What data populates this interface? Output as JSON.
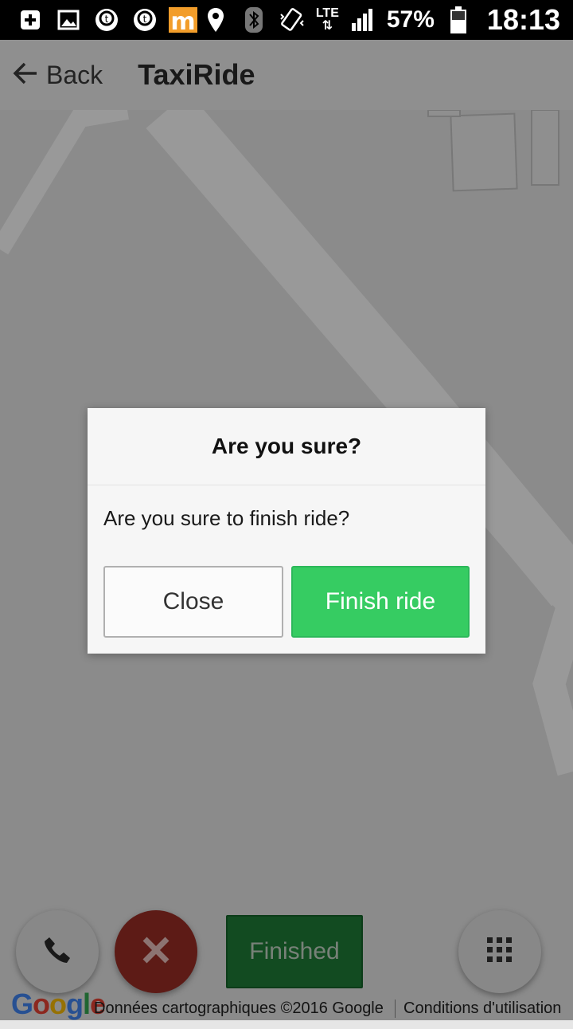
{
  "status_bar": {
    "network": "LTE",
    "battery": "57%",
    "time": "18:13",
    "icons": [
      "add-box-icon",
      "image-icon",
      "tapatalk-icon",
      "tapatalk-icon",
      "m-app-icon",
      "location-icon",
      "bluetooth-icon",
      "vibrate-icon",
      "lte-icon",
      "signal-icon",
      "battery-icon"
    ]
  },
  "app_bar": {
    "back_label": "Back",
    "title": "TaxiRide"
  },
  "dialog": {
    "title": "Are you sure?",
    "message": "Are you sure to finish ride?",
    "close_label": "Close",
    "confirm_label": "Finish ride"
  },
  "controls": {
    "finished_label": "Finished"
  },
  "map": {
    "logo": "Google",
    "credit": "Données cartographiques ©2016 Google",
    "terms": "Conditions d'utilisation"
  },
  "colors": {
    "confirm_green": "#36cc62",
    "finished_green": "#1f7d37",
    "cancel_red": "#9b2e26"
  }
}
